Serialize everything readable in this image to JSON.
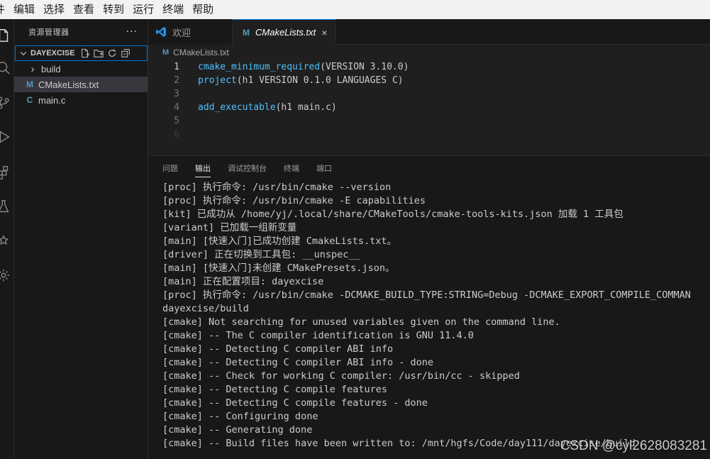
{
  "menubar": [
    "件",
    "编辑",
    "选择",
    "查看",
    "转到",
    "运行",
    "终端",
    "帮助"
  ],
  "activitybar": [
    "files-icon",
    "search-icon",
    "source-control-icon",
    "run-debug-icon",
    "extensions-icon",
    "testing-icon",
    "cmake-icon",
    "remote-icon"
  ],
  "sidebar": {
    "title": "资源管理器",
    "more": "···",
    "folder": "DAYEXCISE",
    "items": [
      {
        "label": "build",
        "icon": "›",
        "kind": "folder"
      },
      {
        "label": "CMakeLists.txt",
        "icon": "M",
        "kind": "cmake",
        "selected": true
      },
      {
        "label": "main.c",
        "icon": "C",
        "kind": "c"
      }
    ]
  },
  "tabs": [
    {
      "label": "欢迎",
      "active": false
    },
    {
      "label": "CMakeLists.txt",
      "active": true,
      "icon": "M",
      "close": "×"
    }
  ],
  "breadcrumb": {
    "icon": "M",
    "label": "CMakeLists.txt"
  },
  "editor": {
    "lines": [
      {
        "no": "1",
        "fn": "cmake_minimum_required",
        "rest": "(VERSION 3.10.0)"
      },
      {
        "no": "2",
        "fn": "project",
        "rest": "(h1 VERSION 0.1.0 LANGUAGES C)"
      },
      {
        "no": "3",
        "fn": "",
        "rest": ""
      },
      {
        "no": "4",
        "fn": "add_executable",
        "rest": "(h1 main.c)"
      },
      {
        "no": "5",
        "fn": "",
        "rest": ""
      },
      {
        "no": "6",
        "fn": "",
        "rest": ""
      }
    ]
  },
  "panel": {
    "tabs": [
      "问题",
      "输出",
      "调试控制台",
      "终端",
      "端口"
    ],
    "active_tab": "输出",
    "output": [
      "[proc] 执行命令: /usr/bin/cmake --version",
      "[proc] 执行命令: /usr/bin/cmake -E capabilities",
      "[kit] 已成功从 /home/yj/.local/share/CMakeTools/cmake-tools-kits.json 加载 1 工具包",
      "[variant] 已加载一组新变量",
      "[main] [快速入门]已成功创建 CmakeLists.txt。",
      "[driver] 正在切换到工具包: __unspec__",
      "[main] [快速入门]未创建 CMakePresets.json。",
      "[main] 正在配置项目: dayexcise",
      "[proc] 执行命令: /usr/bin/cmake -DCMAKE_BUILD_TYPE:STRING=Debug -DCMAKE_EXPORT_COMPILE_COMMAN",
      "dayexcise/build",
      "[cmake] Not searching for unused variables given on the command line.",
      "[cmake] -- The C compiler identification is GNU 11.4.0",
      "[cmake] -- Detecting C compiler ABI info",
      "[cmake] -- Detecting C compiler ABI info - done",
      "[cmake] -- Check for working C compiler: /usr/bin/cc - skipped",
      "[cmake] -- Detecting C compile features",
      "[cmake] -- Detecting C compile features - done",
      "[cmake] -- Configuring done",
      "[cmake] -- Generating done",
      "[cmake] -- Build files have been written to: /mnt/hgfs/Code/day111/dayexcise/build"
    ]
  },
  "watermark": "CSDN @cyl2628083281",
  "colors": {
    "accent": "#0078d4",
    "function": "#4fc1ff",
    "cmake_icon": "#519aba"
  }
}
